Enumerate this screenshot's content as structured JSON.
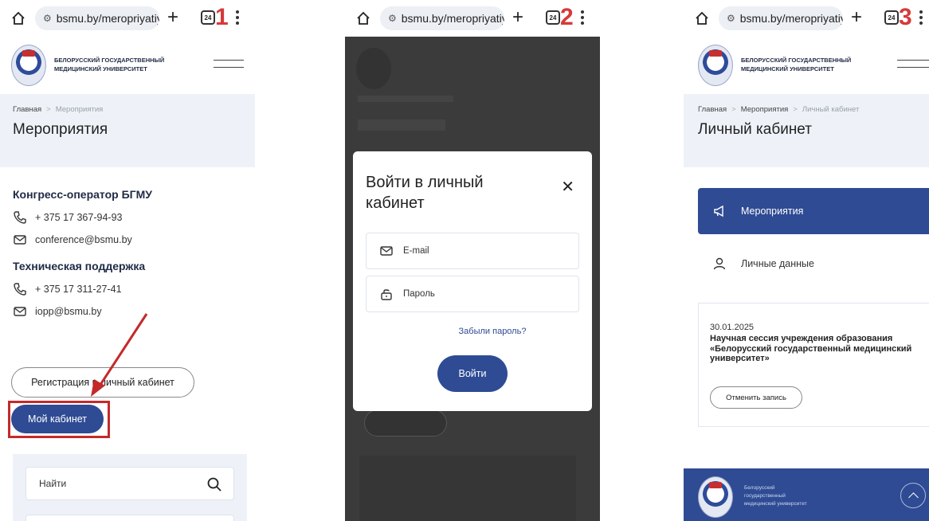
{
  "browser": {
    "url": "bsmu.by/meropriyatiy",
    "tab_count": "24",
    "steps": [
      "1",
      "2",
      "3"
    ]
  },
  "site": {
    "university_line1": "БЕЛОРУССКИЙ ГОСУДАРСТВЕННЫЙ",
    "university_line2": "МЕДИЦИНСКИЙ УНИВЕРСИТЕТ"
  },
  "screen1": {
    "breadcrumb_home": "Главная",
    "breadcrumb_current": "Мероприятия",
    "page_title": "Мероприятия",
    "congress_heading": "Конгресс-оператор БГМУ",
    "congress_phone": "+ 375 17 367-94-93",
    "congress_email": "conference@bsmu.by",
    "support_heading": "Техническая поддержка",
    "support_phone": "+ 375 17 311-27-41",
    "support_email": "iopp@bsmu.by",
    "register_button": "Регистрация в личный кабинет",
    "my_cabinet_button": "Мой кабинет",
    "search_placeholder": "Найти"
  },
  "screen2": {
    "modal_title": "Войти в личный кабинет",
    "email_placeholder": "E-mail",
    "password_placeholder": "Пароль",
    "forgot_link": "Забыли пароль?",
    "login_button": "Войти"
  },
  "screen3": {
    "breadcrumb_home": "Главная",
    "breadcrumb_mid": "Мероприятия",
    "breadcrumb_current": "Личный кабинет",
    "page_title": "Личный кабинет",
    "menu_events": "Мероприятия",
    "menu_personal": "Личные данные",
    "event_date": "30.01.2025",
    "event_title": "Научная сессия учреждения образования «Белорусский государственный медицинский университет»",
    "cancel_button": "Отменить запись",
    "footer_line1": "Белорусский",
    "footer_line2": "государственный",
    "footer_line3": "медицинский университет"
  },
  "colors": {
    "brand_blue": "#2e4b94",
    "highlight_red": "#c42a2a",
    "band_bg": "#eef2f8"
  }
}
